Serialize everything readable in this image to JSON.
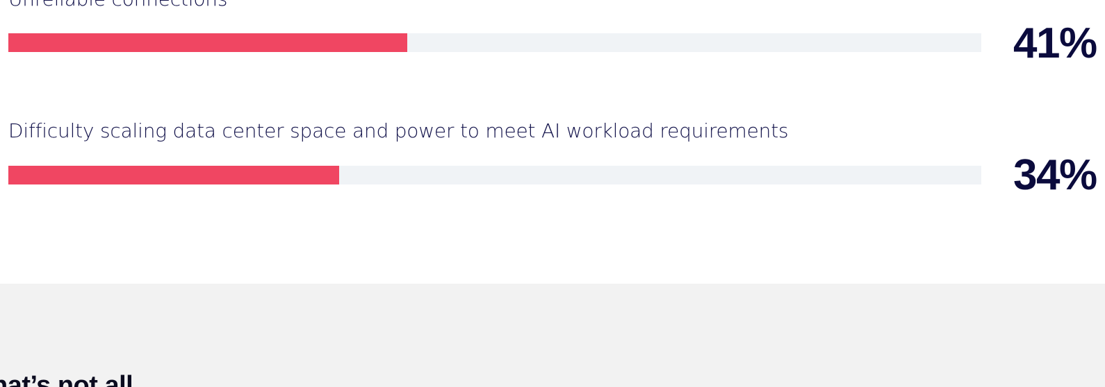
{
  "stats": [
    {
      "label": "Unreliable connections",
      "value_text": "41%",
      "percent": 41
    },
    {
      "label": "Difficulty scaling data center space and power to meet AI workload requirements",
      "value_text": "34%",
      "percent": 34
    }
  ],
  "next_section": {
    "heading": "hat’s not all"
  },
  "colors": {
    "bar_fill": "#f04662",
    "bar_track": "#f0f3f6",
    "text_primary": "#0b0b3d",
    "section_bg": "#f2f2f2"
  }
}
